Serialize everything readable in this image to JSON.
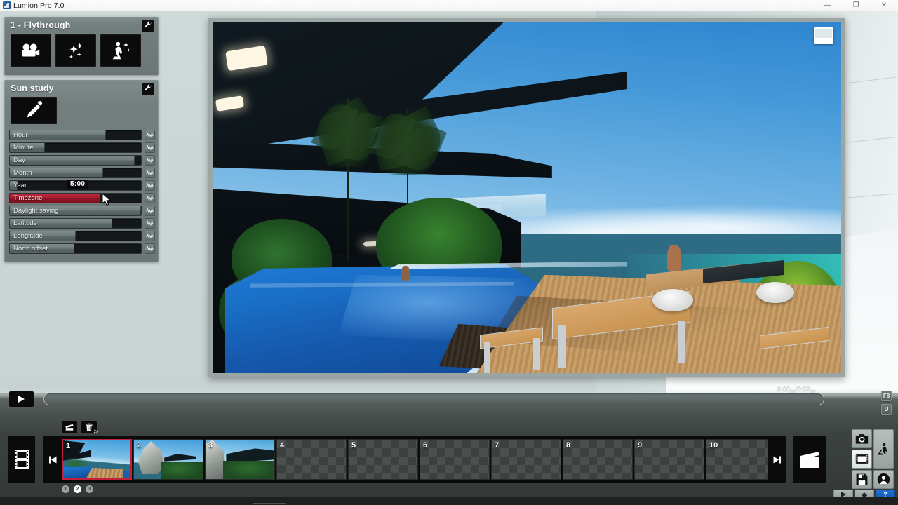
{
  "window": {
    "title": "Lumion Pro 7.0",
    "app_icon": "lumion-logo-icon",
    "controls": [
      {
        "name": "minimize-button",
        "glyph": "—"
      },
      {
        "name": "maximize-button",
        "glyph": "❐"
      },
      {
        "name": "close-button",
        "glyph": "✕"
      }
    ]
  },
  "movie_panel": {
    "title": "1 - Flythrough",
    "settings_icon": "wrench-icon",
    "buttons": [
      {
        "name": "camera-effects-button",
        "icon": "movie-camera-icon"
      },
      {
        "name": "particle-effects-button",
        "icon": "sparkles-icon"
      },
      {
        "name": "effects-library-button",
        "icon": "person-sparkle-icon"
      }
    ]
  },
  "sun_study": {
    "title": "Sun study",
    "settings_icon": "wrench-icon",
    "edit_button": {
      "name": "sun-study-edit-button",
      "icon": "pencil-icon"
    },
    "tooltip_value": "5:00",
    "sliders": [
      {
        "label": "Hour",
        "fill_percent": 73,
        "active": false
      },
      {
        "label": "Minute",
        "fill_percent": 27,
        "active": false
      },
      {
        "label": "Day",
        "fill_percent": 95,
        "active": false
      },
      {
        "label": "Month",
        "fill_percent": 71,
        "active": false
      },
      {
        "label": "Year",
        "fill_percent": 6,
        "active": false
      },
      {
        "label": "Timezone",
        "fill_percent": 69,
        "active": true
      },
      {
        "label": "Daylight saving",
        "fill_percent": 100,
        "active": false
      },
      {
        "label": "Latitude",
        "fill_percent": 78,
        "active": false
      },
      {
        "label": "Longitude",
        "fill_percent": 50,
        "active": false
      },
      {
        "label": "North offset",
        "fill_percent": 49,
        "active": false
      }
    ],
    "curve_icon": "waveform-curve-icon"
  },
  "viewport": {
    "name": "3d-render-viewport",
    "corner_widget": "viewport-thumbnail-widget"
  },
  "timeline": {
    "play_button": {
      "name": "play-button",
      "icon": "play-triangle-icon"
    },
    "scrubber": {
      "name": "timeline-scrubber",
      "position_percent": 0
    },
    "timecode_current": "0:00",
    "timecode_current_frames": "00",
    "timecode_separator": "/",
    "timecode_total": "0:02",
    "timecode_total_frames": "00",
    "keycaps": [
      {
        "name": "key-f8",
        "label": "F8"
      },
      {
        "name": "key-u",
        "label": "U"
      }
    ]
  },
  "clip_tools": [
    {
      "name": "add-clip-button",
      "icon": "clapper-add-icon",
      "badge": ""
    },
    {
      "name": "delete-clip-button",
      "icon": "trash-icon",
      "badge": "2x"
    }
  ],
  "clips_panel": {
    "film_button": {
      "name": "film-strip-button",
      "icon": "film-strip-icon"
    },
    "prev_button": {
      "name": "skip-to-start-button",
      "icon": "skip-back-icon"
    },
    "next_button": {
      "name": "skip-to-end-button",
      "icon": "skip-forward-icon"
    },
    "clips": [
      {
        "number": "1",
        "filled": true,
        "selected": true,
        "thumb": "t1"
      },
      {
        "number": "2",
        "filled": true,
        "selected": false,
        "thumb": "t2"
      },
      {
        "number": "3",
        "filled": true,
        "selected": false,
        "thumb": "t3"
      },
      {
        "number": "4",
        "filled": false,
        "selected": false,
        "thumb": ""
      },
      {
        "number": "5",
        "filled": false,
        "selected": false,
        "thumb": ""
      },
      {
        "number": "6",
        "filled": false,
        "selected": false,
        "thumb": ""
      },
      {
        "number": "7",
        "filled": false,
        "selected": false,
        "thumb": ""
      },
      {
        "number": "8",
        "filled": false,
        "selected": false,
        "thumb": ""
      },
      {
        "number": "9",
        "filled": false,
        "selected": false,
        "thumb": ""
      },
      {
        "number": "10",
        "filled": false,
        "selected": false,
        "thumb": ""
      }
    ],
    "page_dots": [
      {
        "label": "1",
        "active": false
      },
      {
        "label": "2",
        "active": true
      },
      {
        "label": "3",
        "active": false
      }
    ]
  },
  "right_dock": {
    "movie_mode_button": {
      "name": "movie-mode-button",
      "icon": "clapperboard-icon"
    },
    "buttons": [
      {
        "name": "photo-mode-button",
        "icon": "camera-icon",
        "active": false
      },
      {
        "name": "build-mode-button",
        "icon": "person-worker-icon",
        "active": false
      },
      {
        "name": "movie-mode-button-2",
        "icon": "film-reel-icon",
        "active": true
      },
      {
        "name": "save-button",
        "icon": "floppy-disk-icon",
        "active": false
      },
      {
        "name": "panorama-button",
        "icon": "person-circle-icon",
        "active": false
      }
    ],
    "bottom_buttons": [
      {
        "name": "playback-button",
        "icon": "play-triangle-icon",
        "label": ""
      },
      {
        "name": "settings-button",
        "icon": "gear-icon",
        "label": ""
      },
      {
        "name": "help-button",
        "icon": "",
        "label": "?"
      }
    ]
  },
  "colors": {
    "panel_bg": "#737e7e",
    "accent_red": "#a61e30",
    "slider_track": "#15181a",
    "selected_clip_border": "#c3203a",
    "help_blue": "#1559b4",
    "desktop_bg": "#cbd5d4"
  }
}
